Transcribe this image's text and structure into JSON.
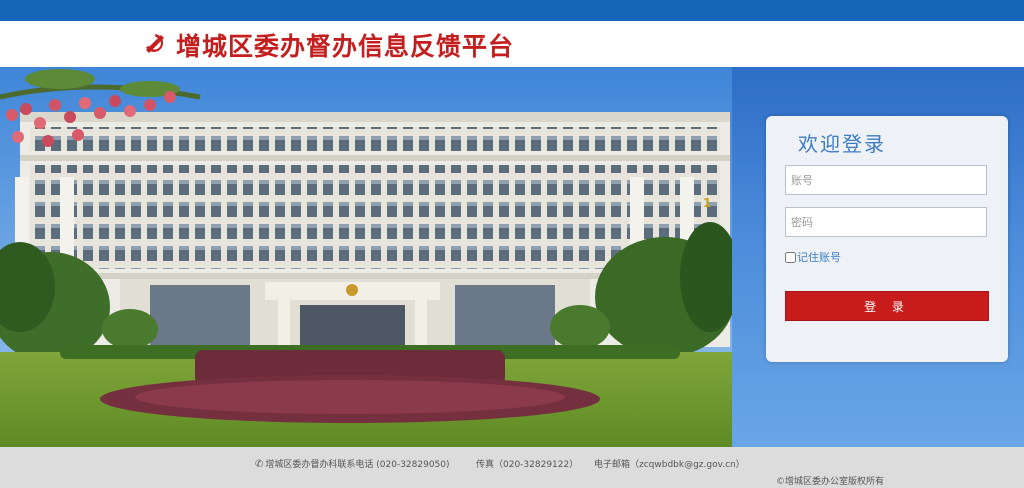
{
  "header": {
    "title": "增城区委办督办信息反馈平台",
    "brand_color": "#c41e1e",
    "top_bar_color": "#1565b9"
  },
  "login": {
    "title": "欢迎登录",
    "username_placeholder": "账号",
    "password_placeholder": "密码",
    "remember_label": "记住账号",
    "submit_label": "登 录",
    "submit_color": "#c81c1c"
  },
  "footer": {
    "phone": "增城区委办督办科联系电话 (020-32829050)",
    "fax": "传真（020-32829122）",
    "email": "电子邮箱（zcqwbdbk@gz.gov.cn）",
    "copyright": "©增城区委办公室版权所有",
    "icons": [
      "phone-icon"
    ]
  },
  "hero": {
    "building_sign": "1"
  }
}
